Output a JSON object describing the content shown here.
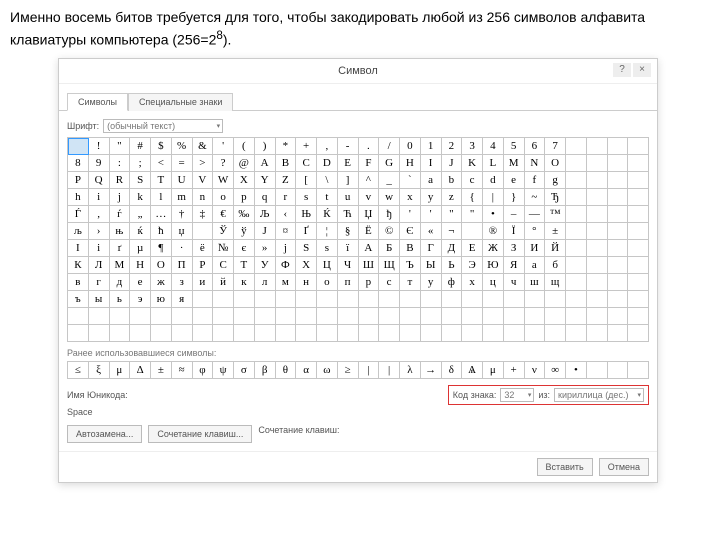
{
  "caption_text": "Именно восемь битов требуется для того, чтобы закодировать любой из 256 символов алфавита клавиатуры компьютера (256=2",
  "caption_sup": "8",
  "caption_tail": ").",
  "dialog": {
    "title": "Символ",
    "help": "?",
    "close": "×",
    "tabs": [
      "Символы",
      "Специальные знаки"
    ],
    "font_label": "Шрифт:",
    "font_value": "(обычный текст)",
    "recent_label": "Ранее использовавшиеся символы:",
    "unicode_name_label": "Имя Юникода:",
    "unicode_name_value": "Space",
    "autocorrect_btn": "Автозамена...",
    "shortcut_btn": "Сочетание клавиш...",
    "shortcut_label": "Сочетание клавиш:",
    "code_label": "Код знака:",
    "code_value": "32",
    "from_label": "из:",
    "from_value": "кириллица (дес.)",
    "insert_btn": "Вставить",
    "cancel_btn": "Отмена"
  },
  "grid_rows": [
    [
      " ",
      "!",
      "\"",
      "#",
      "$",
      "%",
      "&",
      "'",
      "(",
      ")",
      "*",
      "+",
      ",",
      "-",
      ".",
      "/",
      "0",
      "1",
      "2",
      "3",
      "4",
      "5",
      "6",
      "7"
    ],
    [
      "8",
      "9",
      ":",
      ";",
      "<",
      "=",
      ">",
      "?",
      "@",
      "A",
      "B",
      "C",
      "D",
      "E",
      "F",
      "G",
      "H",
      "I",
      "J",
      "K",
      "L",
      "M",
      "N",
      "O"
    ],
    [
      "P",
      "Q",
      "R",
      "S",
      "T",
      "U",
      "V",
      "W",
      "X",
      "Y",
      "Z",
      "[",
      "\\",
      "]",
      "^",
      "_",
      "`",
      "a",
      "b",
      "c",
      "d",
      "e",
      "f",
      "g"
    ],
    [
      "h",
      "i",
      "j",
      "k",
      "l",
      "m",
      "n",
      "o",
      "p",
      "q",
      "r",
      "s",
      "t",
      "u",
      "v",
      "w",
      "x",
      "y",
      "z",
      "{",
      "|",
      "}",
      "~",
      "Ђ"
    ],
    [
      "Ѓ",
      "‚",
      "ѓ",
      "„",
      "…",
      "†",
      "‡",
      "€",
      "‰",
      "Љ",
      "‹",
      "Њ",
      "Ќ",
      "Ћ",
      "Џ",
      "ђ",
      "'",
      "'",
      "\"",
      "\"",
      "•",
      "–",
      "—",
      "™"
    ],
    [
      "љ",
      "›",
      "њ",
      "ќ",
      "ћ",
      "џ",
      " ",
      "Ў",
      "ў",
      "Ј",
      "¤",
      "Ґ",
      "¦",
      "§",
      "Ё",
      "©",
      "Є",
      "«",
      "¬",
      "­",
      "®",
      "Ї",
      "°",
      "±"
    ],
    [
      "І",
      "і",
      "ґ",
      "µ",
      "¶",
      "·",
      "ё",
      "№",
      "є",
      "»",
      "ј",
      "Ѕ",
      "ѕ",
      "ї",
      "А",
      "Б",
      "В",
      "Г",
      "Д",
      "Е",
      "Ж",
      "З",
      "И",
      "Й"
    ],
    [
      "К",
      "Л",
      "М",
      "Н",
      "О",
      "П",
      "Р",
      "С",
      "Т",
      "У",
      "Ф",
      "Х",
      "Ц",
      "Ч",
      "Ш",
      "Щ",
      "Ъ",
      "Ы",
      "Ь",
      "Э",
      "Ю",
      "Я",
      "а",
      "б"
    ],
    [
      "в",
      "г",
      "д",
      "е",
      "ж",
      "з",
      "и",
      "й",
      "к",
      "л",
      "м",
      "н",
      "о",
      "п",
      "р",
      "с",
      "т",
      "у",
      "ф",
      "х",
      "ц",
      "ч",
      "ш",
      "щ"
    ],
    [
      "ъ",
      "ы",
      "ь",
      "э",
      "ю",
      "я",
      "",
      "",
      "",
      "",
      "",
      "",
      "",
      "",
      "",
      "",
      "",
      "",
      "",
      "",
      "",
      "",
      "",
      ""
    ],
    [
      "",
      "",
      "",
      "",
      "",
      "",
      "",
      "",
      "",
      "",
      "",
      "",
      "",
      "",
      "",
      "",
      "",
      "",
      "",
      "",
      "",
      "",
      "",
      ""
    ],
    [
      "",
      "",
      "",
      "",
      "",
      "",
      "",
      "",
      "",
      "",
      "",
      "",
      "",
      "",
      "",
      "",
      "",
      "",
      "",
      "",
      "",
      "",
      "",
      ""
    ]
  ],
  "recent_chars": [
    "≤",
    "ξ",
    "μ",
    "Δ",
    "±",
    "≈",
    "φ",
    "ψ",
    "σ",
    "β",
    "θ",
    "α",
    "ω",
    "≥",
    "|",
    "|",
    "λ",
    "→",
    "δ",
    "Ѧ",
    "μ",
    "+",
    "ν",
    "∞",
    "•"
  ],
  "grid_cols": 28,
  "selected_index": 0
}
